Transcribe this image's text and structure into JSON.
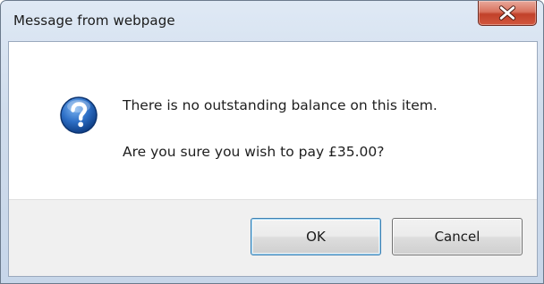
{
  "dialog": {
    "title": "Message from webpage",
    "message_line1": "There is no outstanding balance on this item.",
    "message_line2": "Are you sure you wish to pay £35.00?",
    "icon": "question-icon",
    "close_icon": "close-icon",
    "ok_label": "OK",
    "cancel_label": "Cancel"
  },
  "colors": {
    "close_button": "#c9503a",
    "question_icon": "#1f5fb6",
    "default_button_border": "#3c7fb1"
  }
}
